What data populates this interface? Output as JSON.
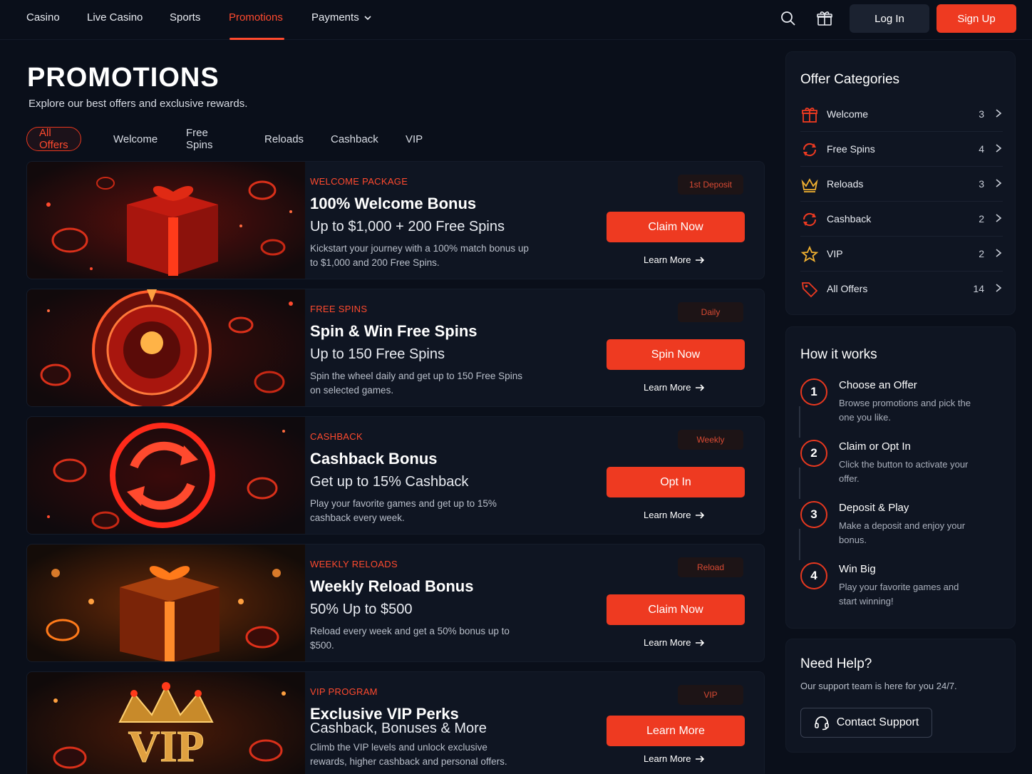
{
  "nav": {
    "items": [
      "Casino",
      "Live Casino",
      "Sports",
      "Promotions",
      "Payments"
    ],
    "active": "Promotions",
    "login": "Log In",
    "signup": "Sign Up"
  },
  "header": {
    "title": "PROMOTIONS",
    "subtitle": "Explore our best offers and exclusive rewards."
  },
  "filters": [
    "All Offers",
    "Welcome",
    "Free Spins",
    "Reloads",
    "Cashback",
    "VIP"
  ],
  "promos": [
    {
      "tag": "WELCOME PACKAGE",
      "title": "100% Welcome Bonus",
      "sub": "Up to $1,000 + 200 Free Spins",
      "desc": "Kickstart your journey with a 100% match bonus up to $1,000 and 200 Free Spins.",
      "badge": "1st Deposit",
      "cta": "Claim Now",
      "learn": "Learn More",
      "image": "gift-box-red"
    },
    {
      "tag": "FREE SPINS",
      "title": "Spin & Win Free Spins",
      "sub": "Up to 150 Free Spins",
      "desc": "Spin the wheel daily and get up to 150 Free Spins on selected games.",
      "badge": "Daily",
      "cta": "Spin Now",
      "learn": "Learn More",
      "image": "roulette-wheel"
    },
    {
      "tag": "CASHBACK",
      "title": "Cashback Bonus",
      "sub": "Get up to 15% Cashback",
      "desc": "Play your favorite games and get up to 15% cashback every week.",
      "badge": "Weekly",
      "cta": "Opt In",
      "learn": "Learn More",
      "image": "cashback-arrows"
    },
    {
      "tag": "WEEKLY RELOADS",
      "title": "Weekly Reload Bonus",
      "sub": "50% Up to $500",
      "desc": "Reload every week and get a 50% bonus up to $500.",
      "badge": "Reload",
      "cta": "Claim Now",
      "learn": "Learn More",
      "image": "gift-box-gold"
    },
    {
      "tag": "VIP PROGRAM",
      "title": "Exclusive VIP Perks",
      "sub": "Cashback, Bonuses & More",
      "desc": "Climb the VIP levels and unlock exclusive rewards, higher cashback and personal offers.",
      "badge": "VIP",
      "cta": "Learn More",
      "learn": "Learn More",
      "image": "vip-crown",
      "image_text": "VIP"
    }
  ],
  "categories": {
    "title": "Offer Categories",
    "items": [
      {
        "label": "Welcome",
        "count": "3",
        "icon": "gift-icon"
      },
      {
        "label": "Free Spins",
        "count": "4",
        "icon": "spin-icon"
      },
      {
        "label": "Reloads",
        "count": "3",
        "icon": "crown-icon"
      },
      {
        "label": "Cashback",
        "count": "2",
        "icon": "refresh-icon"
      },
      {
        "label": "VIP",
        "count": "2",
        "icon": "star-icon"
      },
      {
        "label": "All Offers",
        "count": "14",
        "icon": "tag-icon"
      }
    ]
  },
  "how": {
    "title": "How it works",
    "steps": [
      {
        "num": "1",
        "title": "Choose an Offer",
        "desc": "Browse promotions and pick the one you like."
      },
      {
        "num": "2",
        "title": "Claim or Opt In",
        "desc": "Click the button to activate your offer."
      },
      {
        "num": "3",
        "title": "Deposit & Play",
        "desc": "Make a deposit and enjoy your bonus."
      },
      {
        "num": "4",
        "title": "Win Big",
        "desc": "Play your favorite games and start winning!"
      }
    ]
  },
  "help": {
    "title": "Need Help?",
    "text": "Our support team is here for you 24/7.",
    "button": "Contact Support"
  },
  "colors": {
    "accent": "#ee3a21",
    "background": "#0a0f1a",
    "card": "#0f1522"
  }
}
